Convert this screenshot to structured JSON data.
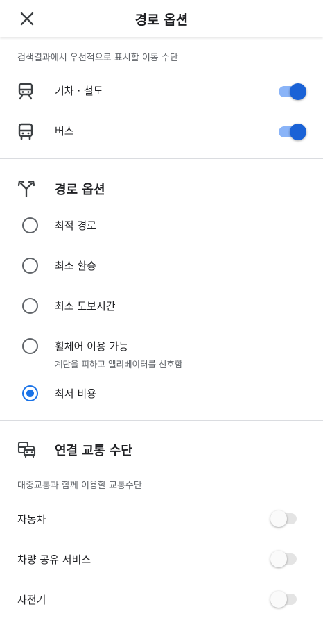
{
  "header": {
    "title": "경로 옵션",
    "close_icon": "close-icon"
  },
  "modes": {
    "subtitle": "검색결과에서 우선적으로 표시할 이동 수단",
    "items": [
      {
        "label": "기차 · 철도",
        "icon": "train-icon",
        "enabled": true
      },
      {
        "label": "버스",
        "icon": "bus-icon",
        "enabled": true
      }
    ]
  },
  "route_options": {
    "title": "경로 옵션",
    "icon": "route-fork-icon",
    "options": [
      {
        "label": "최적 경로",
        "sublabel": "",
        "selected": false
      },
      {
        "label": "최소 환승",
        "sublabel": "",
        "selected": false
      },
      {
        "label": "최소 도보시간",
        "sublabel": "",
        "selected": false
      },
      {
        "label": "휠체어 이용 가능",
        "sublabel": "계단을 피하고 엘리베이터를 선호함",
        "selected": false
      },
      {
        "label": "최저 비용",
        "sublabel": "",
        "selected": true
      }
    ]
  },
  "connections": {
    "title": "연결 교통 수단",
    "icon": "car-transit-icon",
    "subtitle": "대중교통과 함께 이용할 교통수단",
    "items": [
      {
        "label": "자동차",
        "enabled": false
      },
      {
        "label": "차량 공유 서비스",
        "enabled": false
      },
      {
        "label": "자전거",
        "enabled": false
      }
    ]
  },
  "colors": {
    "accent": "#1a62d6",
    "accent_track": "#8ab4f8",
    "divider": "#dadce0",
    "radio_selected": "#1a73e8"
  }
}
